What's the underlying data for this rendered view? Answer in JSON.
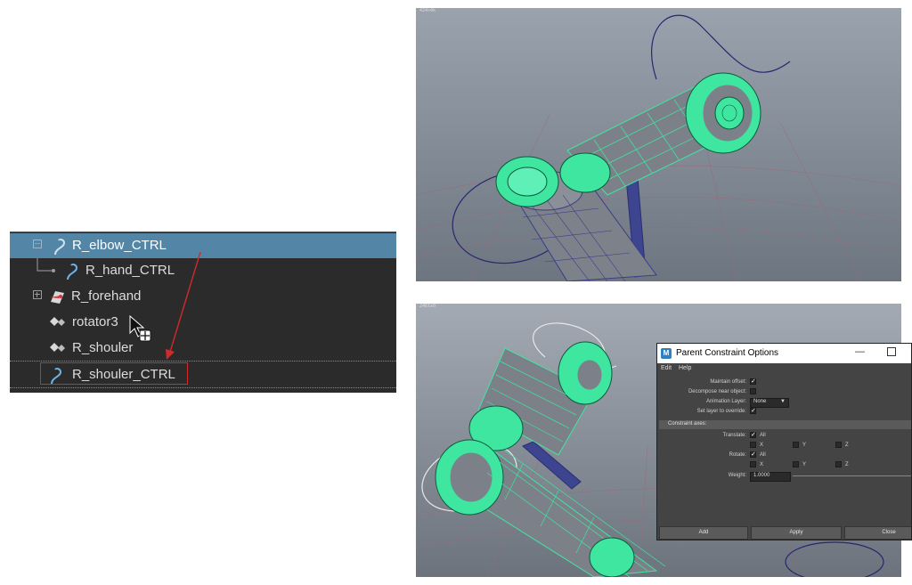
{
  "outliner": {
    "rows": [
      {
        "label": "R_elbow_CTRL",
        "selected": true,
        "icon": "nurbs-curve-icon"
      },
      {
        "label": "R_hand_CTRL",
        "icon": "nurbs-curve-icon"
      },
      {
        "label": "R_forehand",
        "icon": "joint-icon"
      },
      {
        "label": "rotator3",
        "icon": "transform-icon"
      },
      {
        "label": "R_shouler",
        "icon": "transform-icon"
      },
      {
        "label": "R_shouler_CTRL",
        "highlighted": true,
        "icon": "nurbs-curve-icon"
      }
    ],
    "annotation_color": "#d12a2a",
    "selection_color": "#5285a6"
  },
  "viewport_top": {
    "hud": "424x4k"
  },
  "viewport_bottom": {
    "hud": "2461x0"
  },
  "dialog": {
    "title": "Parent Constraint Options",
    "menu": [
      "Edit",
      "Help"
    ],
    "maintain_offset_label": "Maintain offset:",
    "maintain_offset_checked": true,
    "decompose_label": "Decompose near object:",
    "decompose_checked": false,
    "animation_layer_label": "Animation Layer:",
    "animation_layer_value": "None",
    "set_layer_label": "Set layer to override:",
    "set_layer_checked": true,
    "section_title": "Constraint axes:",
    "translate_label": "Translate:",
    "rotate_label": "Rotate:",
    "all_label": "All",
    "x_label": "X",
    "y_label": "Y",
    "z_label": "Z",
    "weight_label": "Weight:",
    "weight_value": "1.0000",
    "buttons": {
      "add": "Add",
      "apply": "Apply",
      "close": "Close"
    }
  },
  "colors": {
    "mesh_green": "#3fe6a0",
    "mesh_gray": "#7d8189",
    "curve_blue": "#2a2f7a",
    "grid_red": "#a45a6a"
  }
}
